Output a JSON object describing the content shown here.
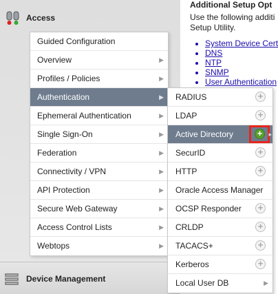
{
  "sidebar": {
    "header_label": "Access",
    "footer_label": "Device Management"
  },
  "content": {
    "title": "Additional Setup Opt",
    "intro_line1": "Use the following additi",
    "intro_line2": "Setup Utility.",
    "links": [
      "System Device Cert",
      "DNS",
      "NTP",
      "SNMP",
      "User Authentication"
    ]
  },
  "menu": {
    "items": [
      {
        "label": "Guided Configuration",
        "has_arrow": false,
        "active": false
      },
      {
        "label": "Overview",
        "has_arrow": true,
        "active": false
      },
      {
        "label": "Profiles / Policies",
        "has_arrow": true,
        "active": false
      },
      {
        "label": "Authentication",
        "has_arrow": true,
        "active": true
      },
      {
        "label": "Ephemeral Authentication",
        "has_arrow": true,
        "active": false
      },
      {
        "label": "Single Sign-On",
        "has_arrow": true,
        "active": false
      },
      {
        "label": "Federation",
        "has_arrow": true,
        "active": false
      },
      {
        "label": "Connectivity / VPN",
        "has_arrow": true,
        "active": false
      },
      {
        "label": "API Protection",
        "has_arrow": true,
        "active": false
      },
      {
        "label": "Secure Web Gateway",
        "has_arrow": true,
        "active": false
      },
      {
        "label": "Access Control Lists",
        "has_arrow": true,
        "active": false
      },
      {
        "label": "Webtops",
        "has_arrow": true,
        "active": false
      }
    ]
  },
  "submenu": {
    "items": [
      {
        "label": "RADIUS",
        "plus": true
      },
      {
        "label": "LDAP",
        "plus": true
      },
      {
        "label": "Active Directory",
        "plus": true,
        "active": true
      },
      {
        "label": "SecurID",
        "plus": true
      },
      {
        "label": "HTTP",
        "plus": true
      },
      {
        "label": "Oracle Access Manager",
        "plus": false
      },
      {
        "label": "OCSP Responder",
        "plus": true
      },
      {
        "label": "CRLDP",
        "plus": true
      },
      {
        "label": "TACACS+",
        "plus": true
      },
      {
        "label": "Kerberos",
        "plus": true
      },
      {
        "label": "Local User DB",
        "plus": false,
        "arrow": true
      }
    ],
    "plus_glyph": "+",
    "colors": {
      "highlight": "#e8261c",
      "active_plus": "#5aa02c",
      "active_bg": "#6e7c8e"
    }
  }
}
